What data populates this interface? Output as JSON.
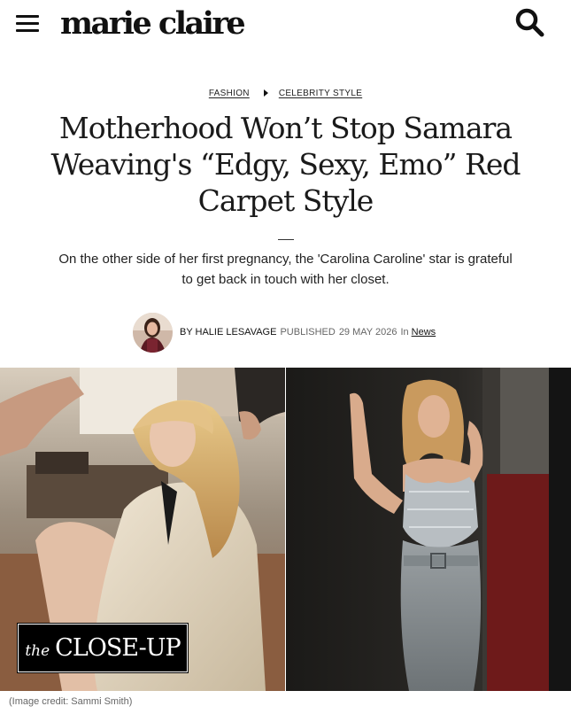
{
  "header": {
    "logo": "marie claire",
    "menu_icon": "hamburger-menu-icon",
    "search_icon": "search-icon"
  },
  "breadcrumb": {
    "items": [
      "FASHION",
      "CELEBRITY STYLE"
    ]
  },
  "article": {
    "headline": "Motherhood Won’t Stop Samara Weaving's “Edgy, Sexy, Emo” Red Carpet Style",
    "standfirst": "On the other side of her first pregnancy, the 'Carolina Caroline' star is grateful to get back in touch with her closet.",
    "byline": {
      "author": "BY HALIE LESAVAGE",
      "published_label": "PUBLISHED",
      "published_date": "29 MAY 2026",
      "in_label": "In",
      "section": "News"
    }
  },
  "hero": {
    "badge_the": "the",
    "badge_main": "CLOSE-UP",
    "image_credit": "(Image credit: Sammi Smith)"
  },
  "colors": {
    "text": "#111111",
    "muted": "#666666",
    "badge_bg": "#000000"
  }
}
